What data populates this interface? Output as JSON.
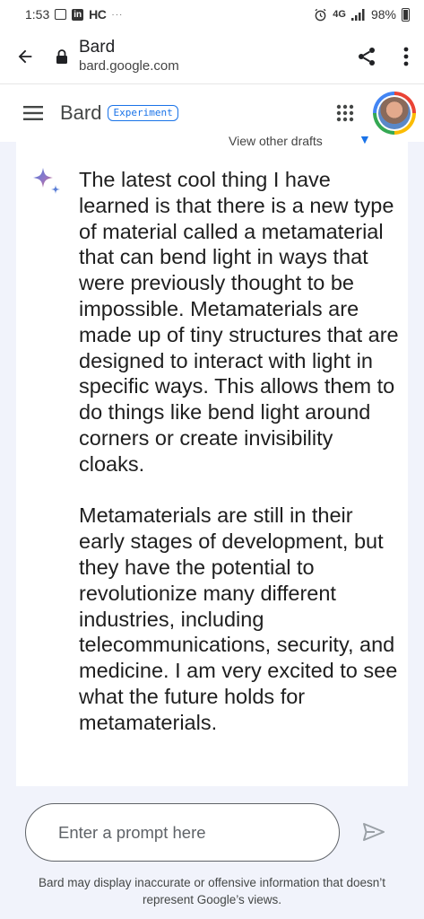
{
  "status_bar": {
    "time": "1:53",
    "carrier_badge": "in",
    "app_label": "HC",
    "overflow": "···",
    "network": "4G",
    "battery": "98%"
  },
  "browser": {
    "page_title": "Bard",
    "url": "bard.google.com",
    "icons": [
      "back-arrow-icon",
      "lock-icon",
      "share-icon",
      "more-vert-icon"
    ]
  },
  "app_header": {
    "name": "Bard",
    "badge": "Experiment",
    "icons": [
      "hamburger-menu-icon",
      "apps-grid-icon",
      "avatar"
    ]
  },
  "drafts": {
    "label": "View other drafts"
  },
  "response": {
    "paragraphs": [
      "The latest cool thing I have learned is that there is a new type of material called a metamaterial that can bend light in ways that were previously thought to be impossible. Metamaterials are made up of tiny structures that are designed to interact with light in specific ways. This allows them to do things like bend light around corners or create invisibility cloaks.",
      "Metamaterials are still in their early stages of development, but they have the potential to revolutionize many different industries, including telecommunications, security, and medicine. I am very excited to see what the future holds for metamaterials."
    ]
  },
  "prompt": {
    "placeholder": "Enter a prompt here",
    "value": ""
  },
  "disclaimer": "Bard may display inaccurate or offensive information that doesn’t represent Google’s views.",
  "colors": {
    "accent": "#1a73e8",
    "page_bg": "#f1f3fb",
    "card_bg": "#ffffff"
  }
}
